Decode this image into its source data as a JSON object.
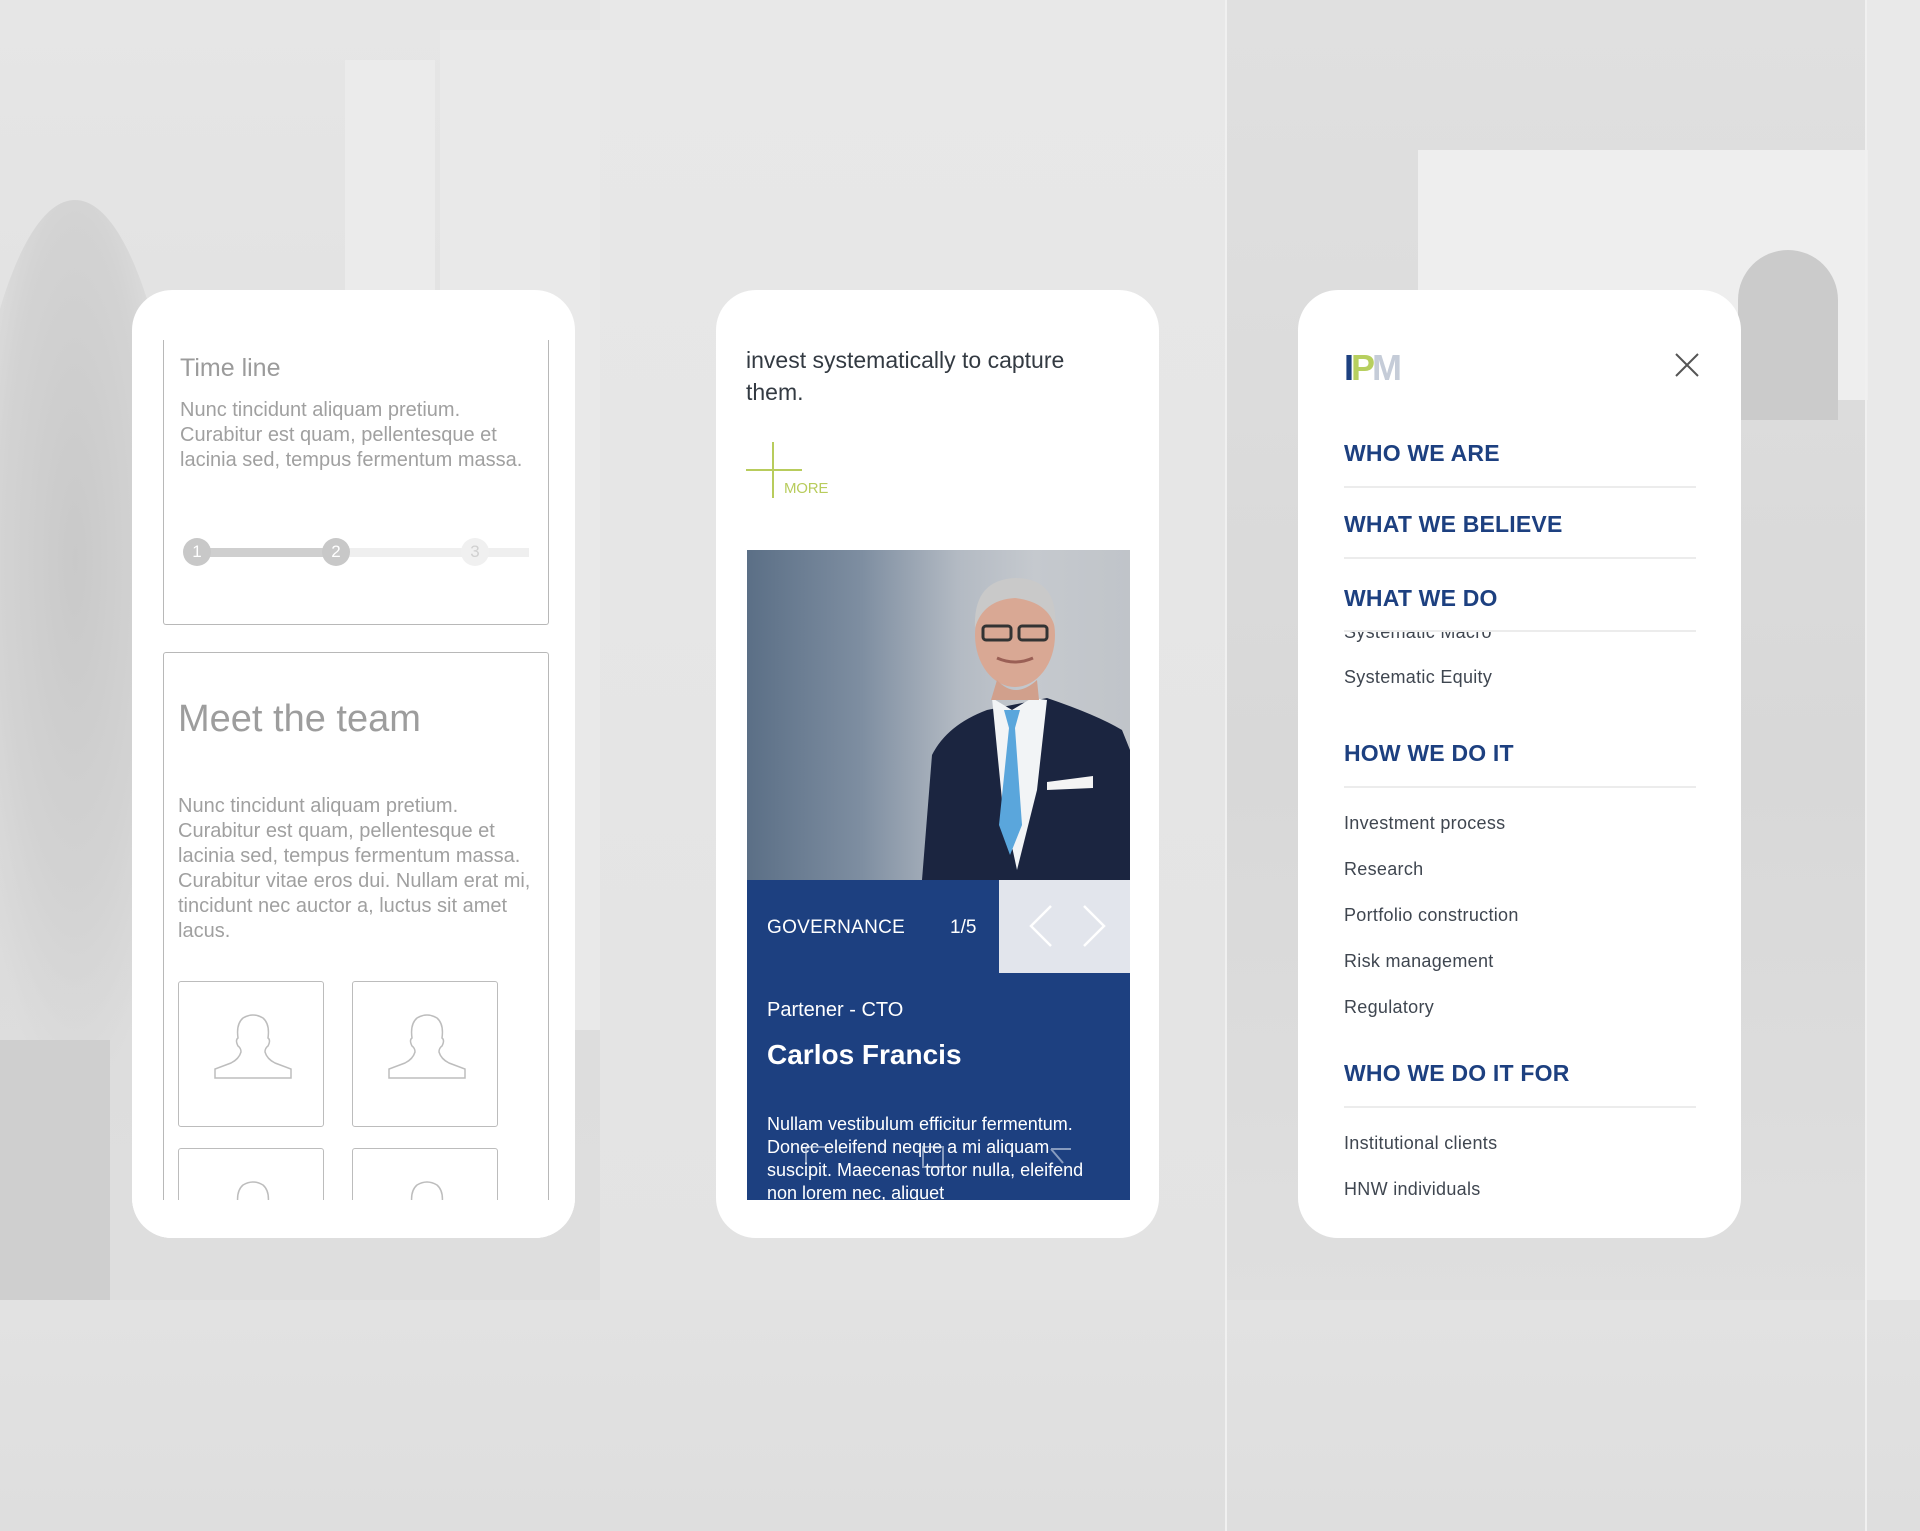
{
  "background": {
    "description": "faded office interior photo"
  },
  "left_phone": {
    "timeline": {
      "title": "Time line",
      "text": "Nunc tincidunt aliquam pretium. Curabitur est quam, pellentesque et lacinia sed, tempus fermentum massa.",
      "steps": [
        "1",
        "2",
        "3"
      ],
      "current_step": 2,
      "progress_fraction": 0.5
    },
    "team": {
      "title": "Meet the team",
      "text": "Nunc tincidunt aliquam pretium. Curabitur est quam, pellentesque et lacinia sed, tempus fermentum massa. Curabitur vitae eros dui. Nullam erat mi, tincidunt nec auctor a, luctus sit amet lacus.",
      "avatars": [
        "user-placeholder-icon",
        "user-placeholder-icon",
        "user-placeholder-icon",
        "user-placeholder-icon"
      ]
    }
  },
  "middle_phone": {
    "intro_text": "invest systematically to capture them.",
    "more_label": "MORE",
    "slider": {
      "category": "GOVERNANCE",
      "counter": "1/5",
      "prev_icon": "chevron-left-icon",
      "next_icon": "chevron-right-icon"
    },
    "person": {
      "role": "Partener - CTO",
      "name": "Carlos Francis",
      "bio": "Nullam vestibulum efficitur fermentum. Donec eleifend neque a mi aliquam suscipit. Maecenas tortor nulla, eleifend non lorem nec, aliquet"
    },
    "system_nav": [
      "recent-apps-icon",
      "home-icon",
      "back-icon"
    ]
  },
  "right_phone": {
    "logo": {
      "i": "I",
      "p": "P",
      "m": "M"
    },
    "close_icon": "close-icon",
    "menu": {
      "who_we_are": "WHO WE ARE",
      "what_we_believe": "WHAT WE BELIEVE",
      "what_we_do": "WHAT WE DO",
      "what_we_do_items": [
        "Systematic Macro",
        "Systematic Equity"
      ],
      "how_we_do_it": "HOW WE DO IT",
      "how_we_do_it_items": [
        "Investment process",
        "Research",
        "Portfolio construction",
        "Risk management",
        "Regulatory"
      ],
      "who_we_do_it_for": "WHO WE DO IT FOR",
      "who_we_do_it_for_items": [
        "Institutional clients",
        "HNW individuals"
      ]
    }
  },
  "colors": {
    "brand_blue": "#1d4080",
    "brand_green": "#b7cf5f",
    "brand_grey": "#c5ccd8",
    "nav_box": "#e2e5ec"
  }
}
